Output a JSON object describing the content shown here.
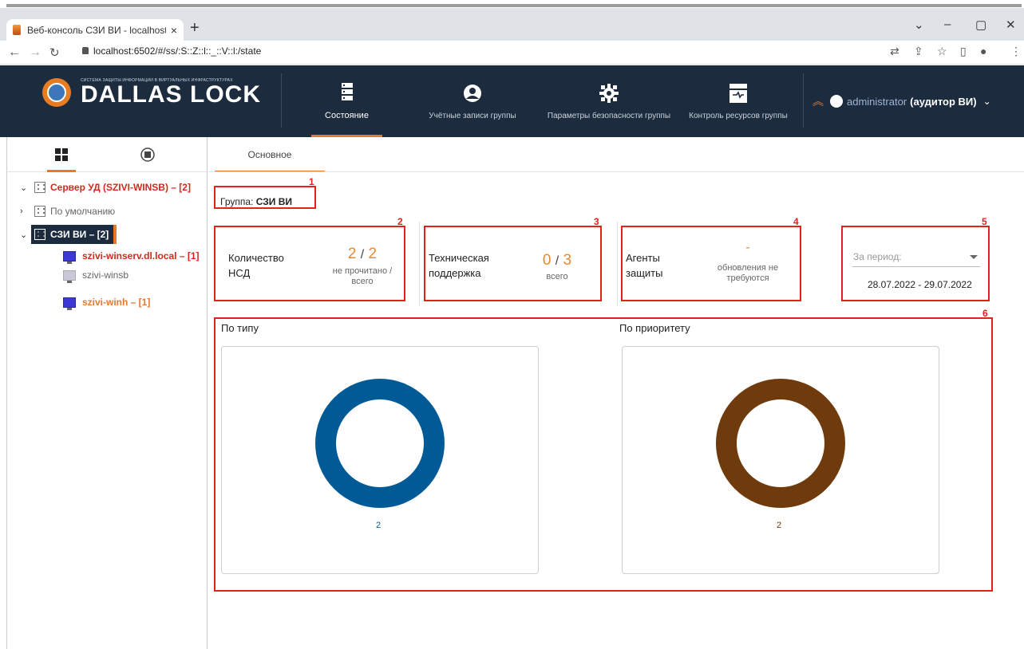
{
  "browser": {
    "tab_title": "Веб-консоль СЗИ ВИ - localhost",
    "tab_close": "×",
    "new_tab": "+",
    "url": "localhost:6502/#/ss/:S::Z::l::_::V::l:/state"
  },
  "header": {
    "logo_small": "СИСТЕМА ЗАЩИТЫ ИНФОРМАЦИИ В ВИРТУАЛЬНЫХ ИНФРАСТРУКТУРАХ",
    "logo_big": "DALLAS LOCK",
    "nav": [
      {
        "label": "Состояние",
        "icon": "server-icon"
      },
      {
        "label": "Учётные записи группы",
        "icon": "user-circle-icon"
      },
      {
        "label": "Параметры безопасности группы",
        "icon": "gear-icon"
      },
      {
        "label": "Контроль ресурсов группы",
        "icon": "resource-control-icon"
      }
    ],
    "user_name": "administrator",
    "user_role": "(аудитор ВИ)"
  },
  "tree": {
    "root": "Сервер УД (SZIVI-WINSB) – [2]",
    "default": "По умолчанию",
    "group": "СЗИ ВИ – [2]",
    "hosts": [
      {
        "label": "szivi-winserv.dl.local – [1]",
        "state": "alert"
      },
      {
        "label": "szivi-winsb",
        "state": "normal"
      },
      {
        "label": "szivi-winh – [1]",
        "state": "warning"
      }
    ]
  },
  "main": {
    "tab": "Основное",
    "group_label": "Группа:",
    "group_name": "СЗИ ВИ",
    "markers": [
      "1",
      "2",
      "3",
      "4",
      "5",
      "6"
    ],
    "nsd": {
      "label1": "Количество",
      "label2": "НСД",
      "unread": "2",
      "sep": "/",
      "total": "2",
      "sub1": "не прочитано /",
      "sub2": "всего"
    },
    "support": {
      "label1": "Техническая",
      "label2": "поддержка",
      "a": "0",
      "sep": "/",
      "b": "3",
      "sub": "всего"
    },
    "agents": {
      "label1": "Агенты",
      "label2": "защиты",
      "value": "-",
      "sub1": "обновления не",
      "sub2": "требуются"
    },
    "period": {
      "placeholder": "За период:",
      "range": "28.07.2022 - 29.07.2022"
    },
    "by_type": {
      "title": "По типу",
      "count": "2",
      "color": "#005a96"
    },
    "by_priority": {
      "title": "По приоритету",
      "count": "2",
      "color": "#6f3a0c"
    }
  },
  "colors": {
    "accent": "#e8772e",
    "header_bg": "#1c2b3e",
    "highlight": "#e2231a"
  }
}
